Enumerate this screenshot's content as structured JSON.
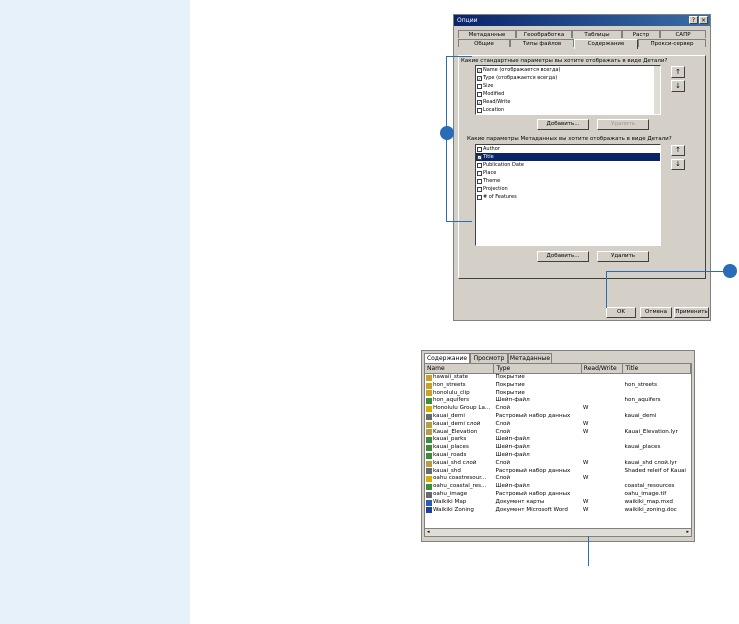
{
  "dialog": {
    "title": "Опции",
    "help_btn": "?",
    "close_btn": "×",
    "tabs_row1": [
      "Метаданные",
      "Геообработка",
      "Таблицы",
      "Растр",
      "САПР"
    ],
    "tabs_row2": [
      "Общие",
      "Типы файлов",
      "Содержание",
      "Прокси-сервер"
    ],
    "standard_label": "Какие стандартные параметры вы хотите отображать в виде Детали?",
    "standard_items": [
      {
        "label": "Name (отображается всегда)",
        "checked": true
      },
      {
        "label": "Type (отображается всегда)",
        "checked": true
      },
      {
        "label": "Size",
        "checked": false
      },
      {
        "label": "Modified",
        "checked": false
      },
      {
        "label": "Read/Write",
        "checked": true
      },
      {
        "label": "Location",
        "checked": false
      }
    ],
    "add_btn1": "Добавить...",
    "remove_btn1": "Удалить",
    "metadata_label": "Какие параметры Метаданных вы хотите отображать в виде Детали?",
    "metadata_items": [
      {
        "label": "Author",
        "checked": false,
        "selected": false
      },
      {
        "label": "Title",
        "checked": true,
        "selected": true
      },
      {
        "label": "Publication Date",
        "checked": false,
        "selected": false
      },
      {
        "label": "Place",
        "checked": false,
        "selected": false
      },
      {
        "label": "Theme",
        "checked": false,
        "selected": false
      },
      {
        "label": "Projection",
        "checked": false,
        "selected": false
      },
      {
        "label": "# of Features",
        "checked": false,
        "selected": false
      }
    ],
    "add_btn2": "Добавить...",
    "remove_btn2": "Удалить",
    "up_arrow": "↑",
    "down_arrow": "↓",
    "ok_btn": "OK",
    "cancel_btn": "Отмена",
    "apply_btn": "Применить"
  },
  "catalog": {
    "tabs": [
      "Содержание",
      "Просмотр",
      "Метаданные"
    ],
    "columns": [
      "Name",
      "Type",
      "Read/Write",
      "Title"
    ],
    "rows": [
      {
        "icon": "coverage",
        "name": "hawaii_state",
        "type": "Покрытие",
        "rw": "",
        "title": ""
      },
      {
        "icon": "coverage",
        "name": "hon_streets",
        "type": "Покрытие",
        "rw": "",
        "title": "hon_streets"
      },
      {
        "icon": "coverage",
        "name": "honolulu_clip",
        "type": "Покрытие",
        "rw": "",
        "title": ""
      },
      {
        "icon": "shapefile",
        "name": "hon_aquifers",
        "type": "Шейп-файл",
        "rw": "",
        "title": "hon_aquifers"
      },
      {
        "icon": "grouplayer",
        "name": "Honolulu Group La...",
        "type": "Слой",
        "rw": "W",
        "title": ""
      },
      {
        "icon": "raster",
        "name": "kauai_demi",
        "type": "Растровый набор данных",
        "rw": "",
        "title": "kauai_demi"
      },
      {
        "icon": "layer",
        "name": "kauai_demi слой",
        "type": "Слой",
        "rw": "W",
        "title": ""
      },
      {
        "icon": "layer",
        "name": "Kauai_Elevation",
        "type": "Слой",
        "rw": "W",
        "title": "Kauai_Elevation.lyr"
      },
      {
        "icon": "shapefile",
        "name": "kauai_parks",
        "type": "Шейп-файл",
        "rw": "",
        "title": ""
      },
      {
        "icon": "shapefile",
        "name": "kauai_places",
        "type": "Шейп-файл",
        "rw": "",
        "title": "kauai_places"
      },
      {
        "icon": "shapefile",
        "name": "kauai_roads",
        "type": "Шейп-файл",
        "rw": "",
        "title": ""
      },
      {
        "icon": "layer",
        "name": "kauai_shd слой",
        "type": "Слой",
        "rw": "W",
        "title": "kauai_shd слой.lyr"
      },
      {
        "icon": "raster",
        "name": "kauai_shd",
        "type": "Растровый набор данных",
        "rw": "",
        "title": "Shaded releif of Kauai"
      },
      {
        "icon": "grouplayer",
        "name": "oahu coastresour...",
        "type": "Слой",
        "rw": "W",
        "title": ""
      },
      {
        "icon": "shapefile",
        "name": "oahu_coastal_res...",
        "type": "Шейп-файл",
        "rw": "",
        "title": "coastal_resources"
      },
      {
        "icon": "raster",
        "name": "oahu_image",
        "type": "Растровый набор данных",
        "rw": "",
        "title": "oahu_image.tif"
      },
      {
        "icon": "map",
        "name": "Waikiki Map",
        "type": "Документ карты",
        "rw": "W",
        "title": "waikiki_map.mxd"
      },
      {
        "icon": "word",
        "name": "Waikiki Zoning",
        "type": "Документ Microsoft Word",
        "rw": "W",
        "title": "waikiki_zoning.doc"
      }
    ],
    "scroll_left": "◂",
    "scroll_right": "▸"
  },
  "colors": {
    "callout": "#2a6cb8",
    "sidebar": "#e6f1fa",
    "selection": "#0a246a"
  }
}
